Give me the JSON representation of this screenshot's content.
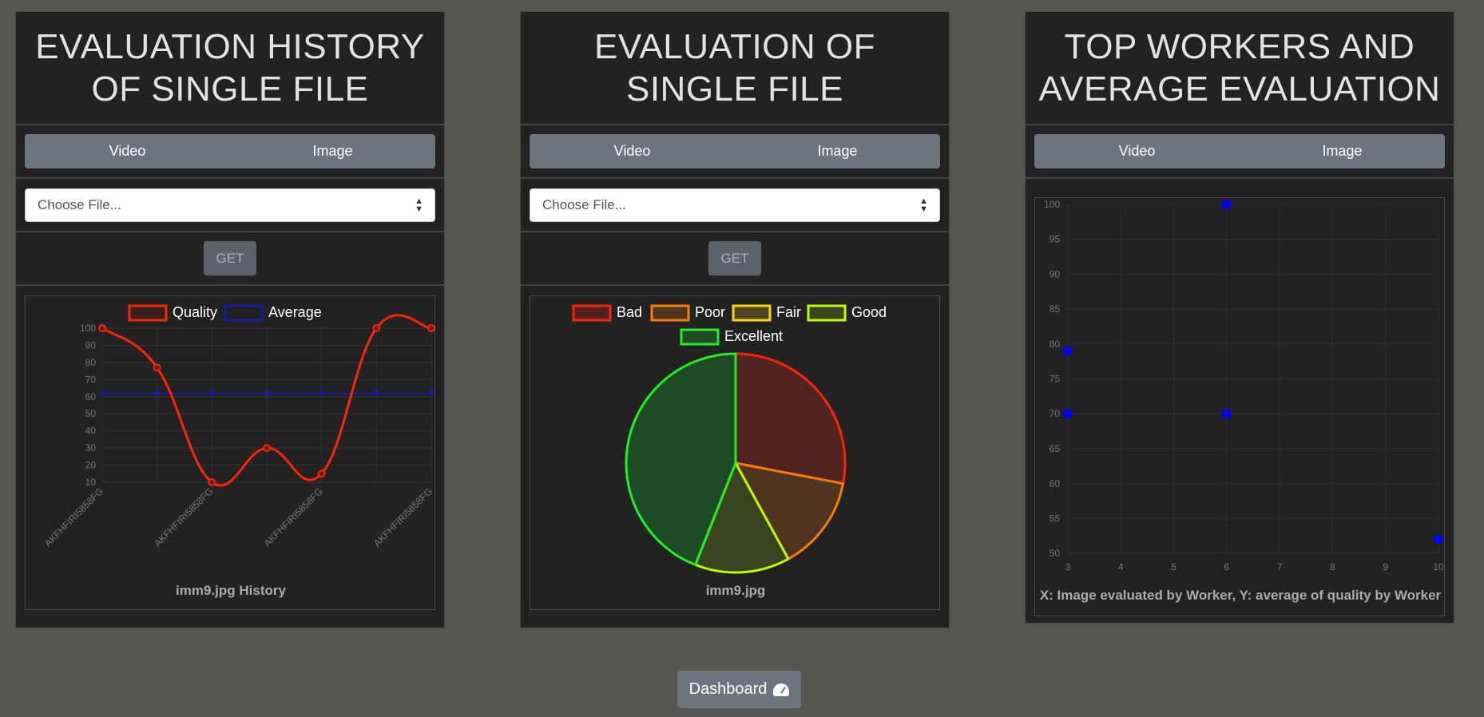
{
  "panels": [
    {
      "title_line1": "EVALUATION HISTORY",
      "title_line2": "OF SINGLE FILE",
      "toggle": [
        "Video",
        "Image"
      ],
      "select_placeholder": "Choose File...",
      "get_label": "GET"
    },
    {
      "title_line1": "EVALUATION OF",
      "title_line2": "SINGLE FILE",
      "toggle": [
        "Video",
        "Image"
      ],
      "select_placeholder": "Choose File...",
      "get_label": "GET"
    },
    {
      "title_line1": "TOP WORKERS AND",
      "title_line2": "AVERAGE EVALUATION",
      "toggle": [
        "Video",
        "Image"
      ]
    }
  ],
  "dashboard_label": "Dashboard",
  "chart_data": [
    {
      "type": "line",
      "title": "imm9.jpg History",
      "categories": [
        "AKFHFIRI5858FG",
        "AKFHFIRI5858FG",
        "AKFHFIRI5858FG",
        "AKFHFIRI5858FG",
        "AKFHFIRI5858FG",
        "AKFHFIRI5858FG",
        "AKFHFIRI5858FG"
      ],
      "tick_labels_shown": [
        "AKFHFIRI5858FG",
        "AKFHFIRI5858FG",
        "AKFHFIRI5858FG",
        "AKFHFIRI5858FG"
      ],
      "series": [
        {
          "name": "Quality",
          "color": "#ff2200",
          "values": [
            100,
            77,
            10,
            30,
            15,
            100,
            100
          ]
        },
        {
          "name": "Average",
          "color": "#1a1aa6",
          "values": [
            62,
            62,
            62,
            62,
            62,
            62,
            62
          ]
        }
      ],
      "yticks": [
        100,
        90,
        80,
        70,
        60,
        50,
        40,
        30,
        20,
        10
      ],
      "ylim": [
        10,
        100
      ],
      "legend": "top",
      "grid": true
    },
    {
      "type": "pie",
      "title": "imm9.jpg",
      "slices": [
        {
          "label": "Bad",
          "value": 28,
          "border": "#ff2200",
          "fill": "#512320"
        },
        {
          "label": "Poor",
          "value": 14,
          "border": "#ff7a00",
          "fill": "#4f341f"
        },
        {
          "label": "Fair",
          "value": 0,
          "border": "#ffd400",
          "fill": "#4f4520"
        },
        {
          "label": "Good",
          "value": 14,
          "border": "#b8ff00",
          "fill": "#3b4420"
        },
        {
          "label": "Excellent",
          "value": 44,
          "border": "#22ee22",
          "fill": "#1c4b24"
        }
      ],
      "legend": "top"
    },
    {
      "type": "scatter",
      "xlabel": "X: Image evaluated by Worker, Y: average of quality by Worker",
      "points": [
        {
          "x": 3,
          "y": 79
        },
        {
          "x": 3,
          "y": 70
        },
        {
          "x": 6,
          "y": 100
        },
        {
          "x": 6,
          "y": 70
        },
        {
          "x": 10,
          "y": 52
        }
      ],
      "point_color": "#0000ff",
      "xticks": [
        3,
        4,
        5,
        6,
        7,
        8,
        9,
        10
      ],
      "yticks": [
        100,
        95,
        90,
        85,
        80,
        75,
        70,
        65,
        60,
        55,
        50
      ],
      "xlim": [
        3,
        10
      ],
      "ylim": [
        50,
        100
      ],
      "grid": true
    }
  ]
}
